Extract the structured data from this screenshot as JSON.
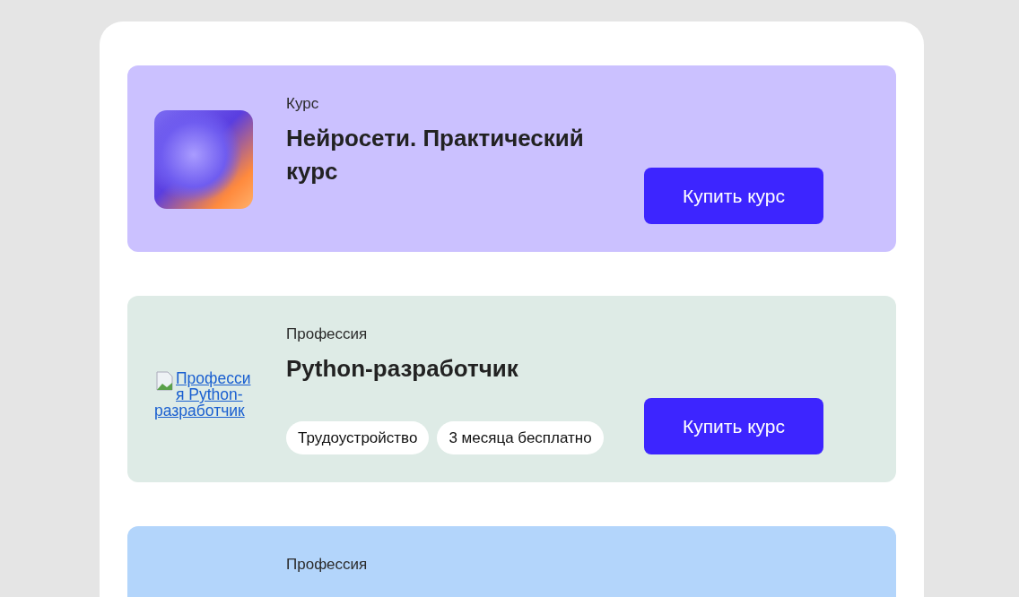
{
  "cards": [
    {
      "color": "#cbc1ff",
      "image": {
        "kind": "artwork"
      },
      "label": "Курс",
      "title": "Нейросети. Практический курс",
      "button": "Купить курс"
    },
    {
      "color": "#deebe6",
      "image": {
        "kind": "broken",
        "alt": "Профессия Python-разработчик"
      },
      "label": "Профессия",
      "title": "Python-разработчик",
      "tags": [
        "Трудоустройство",
        "3 месяца бесплатно"
      ],
      "button": "Купить курс"
    },
    {
      "color": "#b3d5fb",
      "label": "Профессия"
    }
  ]
}
